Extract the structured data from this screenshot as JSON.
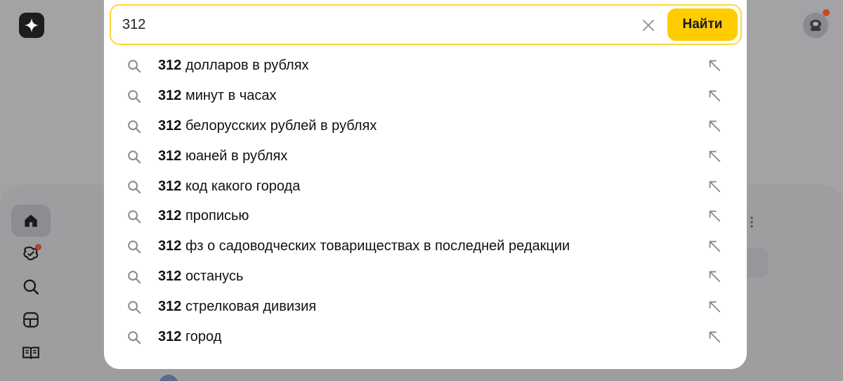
{
  "search": {
    "query": "312",
    "submit_label": "Найти"
  },
  "suggestions": [
    {
      "prefix": "312",
      "rest": "долларов в рублях"
    },
    {
      "prefix": "312",
      "rest": "минут в часах"
    },
    {
      "prefix": "312",
      "rest": "белорусских рублей в рублях"
    },
    {
      "prefix": "312",
      "rest": "юаней в рублях"
    },
    {
      "prefix": "312",
      "rest": "код какого города"
    },
    {
      "prefix": "312",
      "rest": "прописью"
    },
    {
      "prefix": "312",
      "rest": "фз о садоводческих товариществах в последней редакции"
    },
    {
      "prefix": "312",
      "rest": "останусь"
    },
    {
      "prefix": "312",
      "rest": "стрелковая дивизия"
    },
    {
      "prefix": "312",
      "rest": "город"
    }
  ],
  "icons": {
    "logo": "sparkle-logo-icon",
    "clear": "close-icon",
    "suggestion": "search-icon",
    "fill": "arrow-up-left-icon",
    "rail": [
      "home-icon",
      "tasks-icon",
      "search-icon",
      "layout-icon",
      "book-icon"
    ]
  },
  "colors": {
    "accent": "#ffcc00",
    "notification": "#e0522c"
  }
}
